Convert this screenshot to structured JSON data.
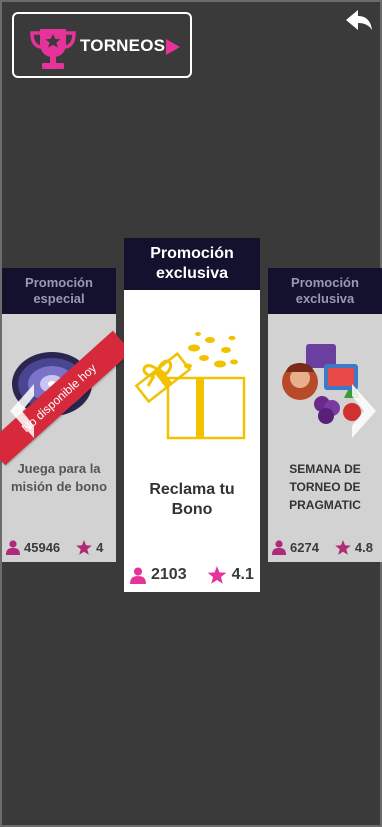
{
  "header": {
    "torneos_label": "TORNEOS"
  },
  "cards": {
    "left": {
      "category": "Promoción especial",
      "title": "Juega para la misión de bono",
      "ribbon": "No disponible hoy",
      "players": "45946",
      "rating": "4"
    },
    "center": {
      "category": "Promoción exclusiva",
      "title": "Reclama tu Bono",
      "players": "2103",
      "rating": "4.1"
    },
    "right": {
      "category": "Promoción exclusiva",
      "title": "SEMANA DE TORNEO DE PRAGMATIC",
      "players": "6274",
      "rating": "4.8"
    }
  },
  "colors": {
    "accent_pink": "#e6339a",
    "card_header": "#14112e",
    "gift_gold": "#f2c200",
    "ribbon_red": "#d62a3c"
  },
  "icons": [
    "trophy-icon",
    "play-icon",
    "back-arrow-icon",
    "user-icon",
    "star-icon",
    "gift-icon",
    "chevron-left-icon",
    "chevron-right-icon"
  ]
}
